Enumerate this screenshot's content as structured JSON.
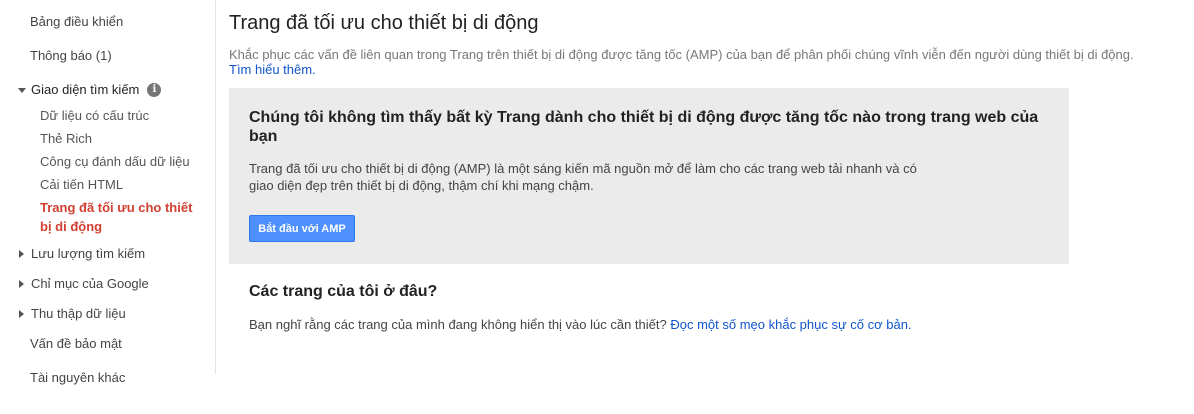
{
  "sidebar": {
    "dashboard": "Bảng điều khiển",
    "messages": "Thông báo (1)",
    "search_appearance": {
      "label": "Giao diện tìm kiếm",
      "info_icon": "i",
      "items": [
        "Dữ liệu có cấu trúc",
        "Thẻ Rich",
        "Công cụ đánh dấu dữ liệu",
        "Cải tiến HTML",
        "Trang đã tối ưu cho thiết bị di động"
      ],
      "active_index": 4
    },
    "search_traffic": "Lưu lượng tìm kiếm",
    "google_index": "Chỉ mục của Google",
    "crawl": "Thu thập dữ liệu",
    "security_issues": "Vấn đề bảo mật",
    "other_resources": "Tài nguyên khác"
  },
  "main": {
    "title": "Trang đã tối ưu cho thiết bị di động",
    "description": "Khắc phục các vấn đề liên quan trong Trang trên thiết bị di động được tăng tốc (AMP) của bạn để phân phối chúng vĩnh viễn đến người dùng thiết bị di động.",
    "learn_more": "Tìm hiểu thêm.",
    "card": {
      "title": "Chúng tôi không tìm thấy bất kỳ Trang dành cho thiết bị di động được tăng tốc nào trong trang web của bạn",
      "body_line1": "Trang đã tối ưu cho thiết bị di động (AMP) là một sáng kiến mã nguồn mở để làm cho các trang web tải nhanh và có",
      "body_line2": "giao diện đẹp trên thiết bị di động, thậm chí khi mạng chậm.",
      "button": "Bắt đầu với AMP"
    },
    "where_title": "Các trang của tôi ở đâu?",
    "where_text": "Bạn nghĩ rằng các trang của mình đang không hiển thị vào lúc cần thiết?",
    "where_link": "Đọc một số mẹo khắc phục sự cố cơ bản."
  },
  "colors": {
    "active_nav": "#d23f31",
    "link": "#1155cc",
    "button": "#4d90fe",
    "card_bg": "#ebebeb"
  }
}
